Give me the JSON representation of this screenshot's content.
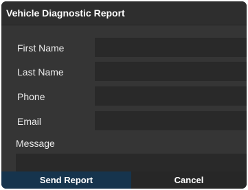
{
  "dialog": {
    "title": "Vehicle Diagnostic Report"
  },
  "form": {
    "first_name": {
      "label": "First Name",
      "value": ""
    },
    "last_name": {
      "label": "Last Name",
      "value": ""
    },
    "phone": {
      "label": "Phone",
      "value": ""
    },
    "email": {
      "label": "Email",
      "value": ""
    },
    "message": {
      "label": "Message",
      "value": ""
    }
  },
  "buttons": {
    "send": "Send Report",
    "cancel": "Cancel"
  },
  "colors": {
    "dialog_background": "#353535",
    "field_background": "#292929",
    "send_button": "#16344d",
    "cancel_button": "#272727",
    "text": "#ececec"
  }
}
